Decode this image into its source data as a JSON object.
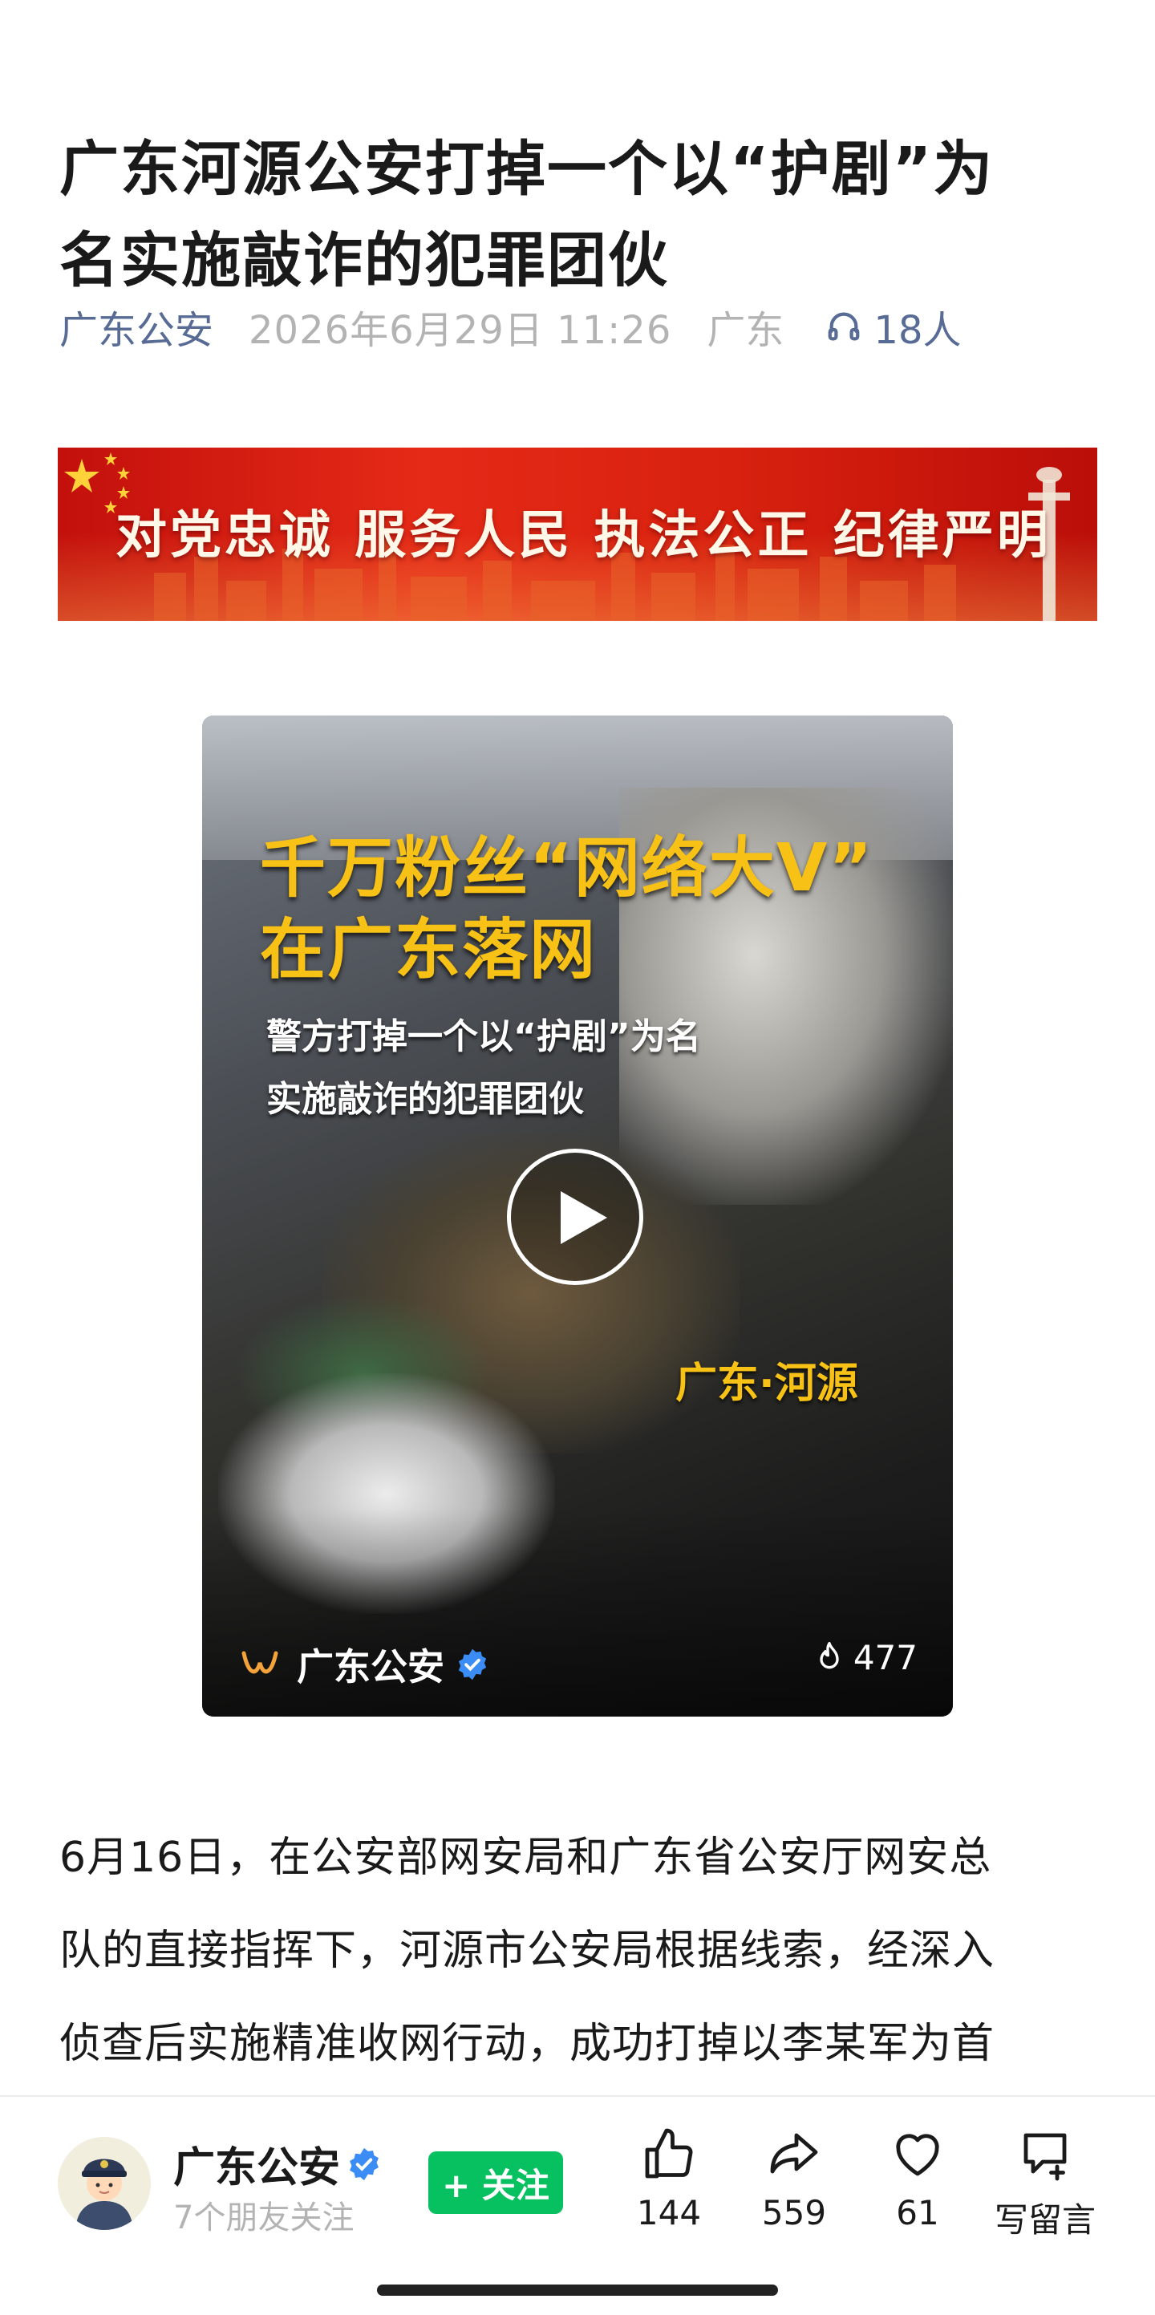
{
  "article": {
    "title_line1": "广东河源公安打掉一个以“护剧”为",
    "title_line2": "名实施敲诈的犯罪团伙",
    "author": "广东公安",
    "date": "2026年6月29日 11:26",
    "region": "广东",
    "listeners": "18人"
  },
  "banner": {
    "slogan": "对党忠诚 服务人民 执法公正 纪律严明"
  },
  "video": {
    "headline_line1": "千万粉丝“网络大V”",
    "headline_line2": "在广东落网",
    "sub_line1": "警方打掉一个以“护剧”为名",
    "sub_line2": "实施敲诈的犯罪团伙",
    "place": "广东·河源",
    "channel_name": "广东公安",
    "heat": "477"
  },
  "body": {
    "line1": "6月16日，在公安部网安局和广东省公安厅网安总",
    "line2": "队的直接指挥下，河源市公安局根据线索，经深入",
    "line3": "侦查后实施精准收网行动，成功打掉以李某军为首"
  },
  "bottom_bar": {
    "account_name": "广东公安",
    "friends_following": "7个朋友关注",
    "follow_label": "+ 关注",
    "like_count": "144",
    "share_count": "559",
    "favorite_count": "61",
    "comment_label": "写留言"
  },
  "colors": {
    "link_blue": "#576b95",
    "follow_green": "#07c160",
    "banner_red": "#d8210f",
    "video_headline_yellow": "#f7c215"
  }
}
